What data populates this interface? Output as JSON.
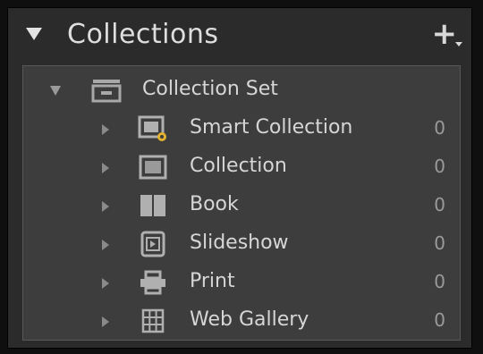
{
  "panel": {
    "title": "Collections",
    "add_icon": "plus-icon"
  },
  "tree": {
    "set": {
      "label": "Collection Set",
      "icon": "collection-set-icon"
    },
    "items": [
      {
        "label": "Smart Collection",
        "count": "0",
        "icon": "smart-collection-icon"
      },
      {
        "label": "Collection",
        "count": "0",
        "icon": "collection-icon"
      },
      {
        "label": "Book",
        "count": "0",
        "icon": "book-icon"
      },
      {
        "label": "Slideshow",
        "count": "0",
        "icon": "slideshow-icon"
      },
      {
        "label": "Print",
        "count": "0",
        "icon": "print-icon"
      },
      {
        "label": "Web Gallery",
        "count": "0",
        "icon": "web-gallery-icon"
      }
    ]
  }
}
